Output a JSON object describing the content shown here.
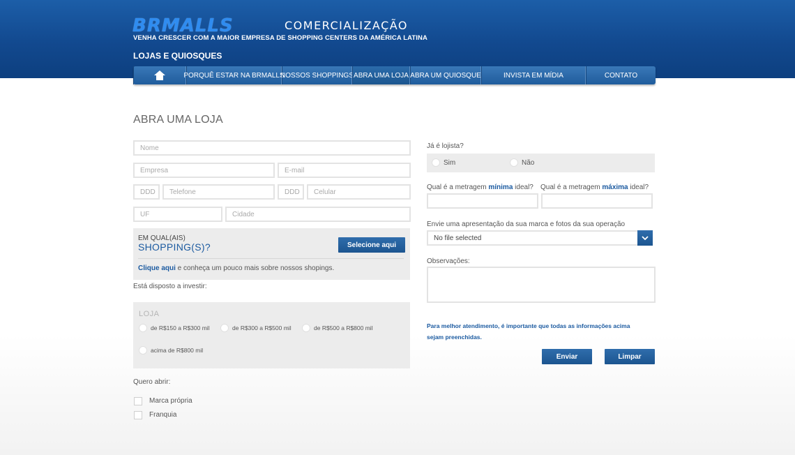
{
  "header": {
    "logo": "BRMALLS",
    "logo_sub": "COMERCIALIZAÇÃO",
    "tagline": "VENHA CRESCER COM A MAIOR EMPRESA DE SHOPPING CENTERS DA AMÉRICA LATINA",
    "section": "LOJAS E QUIOSQUES"
  },
  "nav": {
    "items": [
      "PORQUÊ ESTAR NA BRMALLS",
      "NOSSOS SHOPPINGS",
      "ABRA UMA LOJA",
      "ABRA UM QUIOSQUE",
      "INVISTA EM MÍDIA",
      "CONTATO"
    ],
    "active": "ABRA UMA LOJA"
  },
  "page": {
    "title": "ABRA UMA LOJA"
  },
  "form": {
    "placeholders": {
      "nome": "Nome",
      "empresa": "Empresa",
      "email": "E-mail",
      "ddd1": "DDD",
      "telefone": "Telefone",
      "ddd2": "DDD",
      "celular": "Celular",
      "uf": "UF",
      "cidade": "Cidade"
    },
    "shopping": {
      "line1": "EM QUAL(AIS)",
      "line2": "SHOPPING(S)?",
      "button": "Selecione aqui",
      "link": "Clique aqui",
      "link_rest": " e conheça um pouco mais sobre nossos shopings."
    },
    "invest": {
      "label": "Está disposto a investir:",
      "box_title": "LOJA",
      "options": [
        "de R$150 a R$300 mil",
        "de R$300 a R$500 mil",
        "de R$500 a R$800 mil",
        "acima de R$800 mil"
      ]
    },
    "quero": {
      "label": "Quero abrir:",
      "options": [
        "Marca própria",
        "Franquia"
      ]
    },
    "lojista": {
      "label": "Já é lojista?",
      "sim": "Sim",
      "nao": "Não"
    },
    "metragem": {
      "min_prefix": "Qual é a metragem ",
      "min_word": "mínima",
      "min_suffix": " ideal?",
      "max_prefix": "Qual é a metragem ",
      "max_word": "máxima",
      "max_suffix": " ideal?"
    },
    "upload": {
      "label": "Envie uma apresentação da sua marca e fotos da sua operação",
      "value": "No file selected"
    },
    "observacoes": "Observações:",
    "notice_line1": "Para melhor atendimento, é importante que todas as informações acima",
    "notice_line2": "sejam preenchidas.",
    "buttons": {
      "enviar": "Enviar",
      "limpar": "Limpar"
    }
  },
  "colors": {
    "brand_blue": "#1c5ea8",
    "link_blue": "#1b5aa0",
    "panel_gray": "#ececec"
  }
}
